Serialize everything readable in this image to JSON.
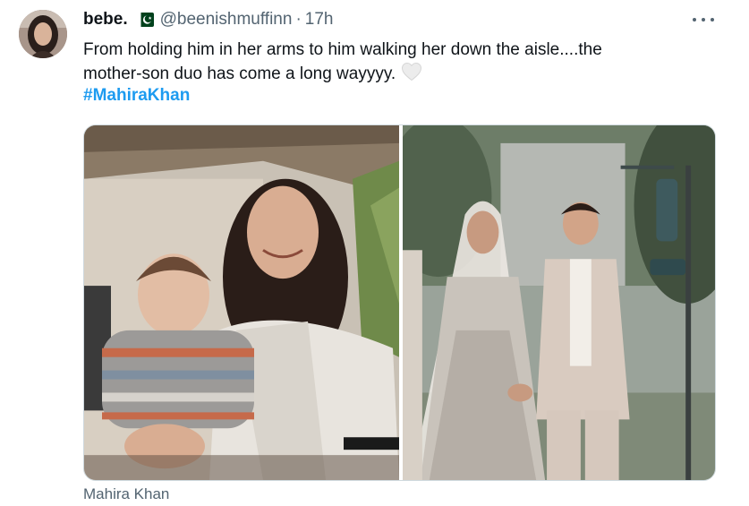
{
  "author": {
    "display_name": "bebe.",
    "handle": "@beenishmuffinn",
    "time": "17h",
    "separator": "·",
    "flag_icon": "pakistan-flag-icon"
  },
  "tweet": {
    "text_line_1": "From holding him in her arms to him walking her down the aisle....the",
    "text_line_2": "mother-son duo has come a long wayyyy.",
    "heart_icon": "white-heart-icon",
    "hashtag": "#MahiraKhan"
  },
  "media": {
    "photos": [
      {
        "subject": "woman-holding-baby-photo"
      },
      {
        "subject": "bride-walking-with-son-photo"
      }
    ],
    "caption": "Mahira Khan"
  },
  "colors": {
    "link": "#1d9bf0",
    "secondary": "#536471",
    "text": "#0f1419",
    "border": "#cfd9de"
  }
}
